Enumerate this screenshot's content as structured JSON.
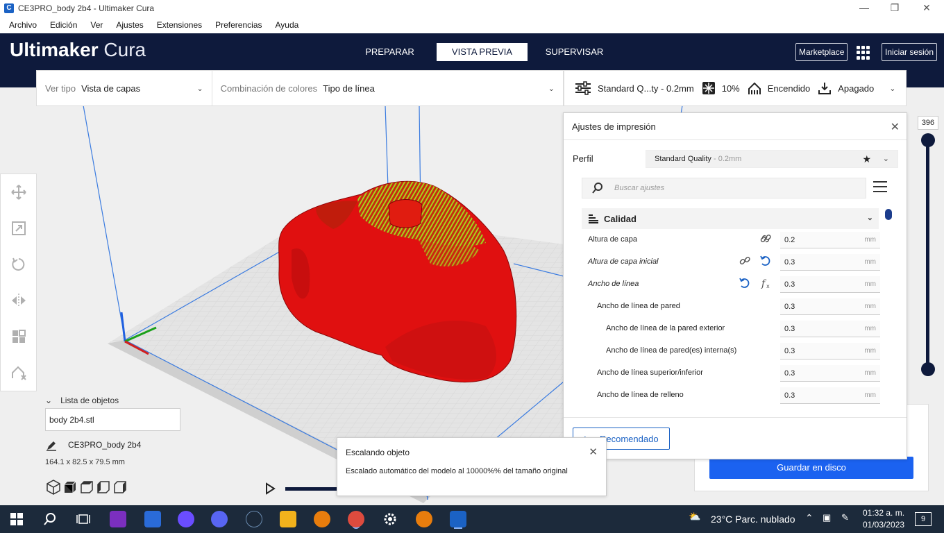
{
  "window": {
    "title": "CE3PRO_body 2b4 - Ultimaker Cura"
  },
  "menu": [
    "Archivo",
    "Edición",
    "Ver",
    "Ajustes",
    "Extensiones",
    "Preferencias",
    "Ayuda"
  ],
  "header": {
    "logo_bold": "Ultimaker",
    "logo_light": "Cura",
    "stages": [
      "PREPARAR",
      "VISTA PREVIA",
      "SUPERVISAR"
    ],
    "active_stage": "VISTA PREVIA",
    "marketplace": "Marketplace",
    "signin": "Iniciar sesión"
  },
  "viewbar": {
    "view_type_label": "Ver tipo",
    "view_type_value": "Vista de capas",
    "color_label": "Combinación de colores",
    "color_value": "Tipo de línea"
  },
  "printbar": {
    "profile": "Standard Q...ty - 0.2mm",
    "infill": "10%",
    "support": "Encendido",
    "adhesion": "Apagado"
  },
  "objects": {
    "list_title": "Lista de objetos",
    "file": "body 2b4.stl",
    "job_name": "CE3PRO_body 2b4",
    "dimensions": "164.1 x 82.5 x 79.5 mm"
  },
  "settings": {
    "title": "Ajustes de impresión",
    "profile_label": "Perfil",
    "profile_value": "Standard Quality",
    "profile_suffix": " - 0.2mm",
    "search_placeholder": "Buscar ajustes",
    "category": "Calidad",
    "rows": [
      {
        "label": "Altura de capa",
        "value": "0.2",
        "unit": "mm"
      },
      {
        "label": "Altura de capa inicial",
        "value": "0.3",
        "unit": "mm"
      },
      {
        "label": "Ancho de línea",
        "value": "0.3",
        "unit": "mm"
      },
      {
        "label": "Ancho de línea de pared",
        "value": "0.3",
        "unit": "mm"
      },
      {
        "label": "Ancho de línea de la pared exterior",
        "value": "0.3",
        "unit": "mm"
      },
      {
        "label": "Ancho de línea de pared(es) interna(s)",
        "value": "0.3",
        "unit": "mm"
      },
      {
        "label": "Ancho de línea superior/inferior",
        "value": "0.3",
        "unit": "mm"
      },
      {
        "label": "Ancho de línea de relleno",
        "value": "0.3",
        "unit": "mm"
      }
    ],
    "recommended_button": "Recomendado"
  },
  "save_button": "Guardar en disco",
  "layer_slider": {
    "value": "396"
  },
  "notification": {
    "title": "Escalando objeto",
    "body": "Escalado automático del modelo al 10000%% del tamaño original"
  },
  "taskbar": {
    "weather": "23°C  Parc. nublado",
    "time": "01:32 a. m.",
    "date": "01/03/2023",
    "notif_count": "9"
  },
  "colors": {
    "header": "#0e1a3c",
    "accent": "#1b62f0",
    "model_red": "#e01010",
    "model_green": "#8fd11a"
  }
}
